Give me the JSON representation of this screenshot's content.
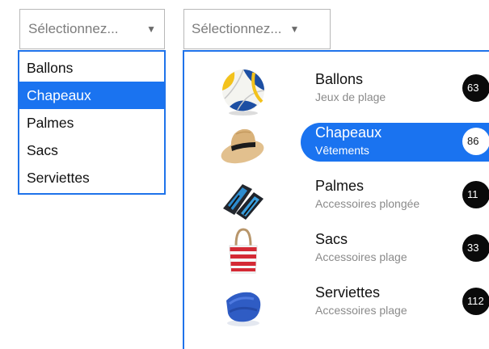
{
  "select_native": {
    "placeholder": "Sélectionnez...",
    "caret": "▼",
    "options": [
      "Ballons",
      "Chapeaux",
      "Palmes",
      "Sacs",
      "Serviettes"
    ],
    "selected": "Chapeaux"
  },
  "select_custom": {
    "placeholder": "Sélectionnez...",
    "caret": "▼",
    "selected": "Chapeaux",
    "items": [
      {
        "name": "Ballons",
        "subtitle": "Jeux de plage",
        "count": "63",
        "icon": "volleyball-icon"
      },
      {
        "name": "Chapeaux",
        "subtitle": "Vêtements",
        "count": "86",
        "icon": "hat-icon"
      },
      {
        "name": "Palmes",
        "subtitle": "Accessoires plongée",
        "count": "11",
        "icon": "flippers-icon"
      },
      {
        "name": "Sacs",
        "subtitle": "Accessoires plage",
        "count": "33",
        "icon": "beach-bag-icon"
      },
      {
        "name": "Serviettes",
        "subtitle": "Accessoires plage",
        "count": "112",
        "icon": "towel-icon"
      }
    ]
  },
  "colors": {
    "accent": "#1a73f0",
    "border": "#1f73ea",
    "badge_bg": "#0a0a0a"
  }
}
